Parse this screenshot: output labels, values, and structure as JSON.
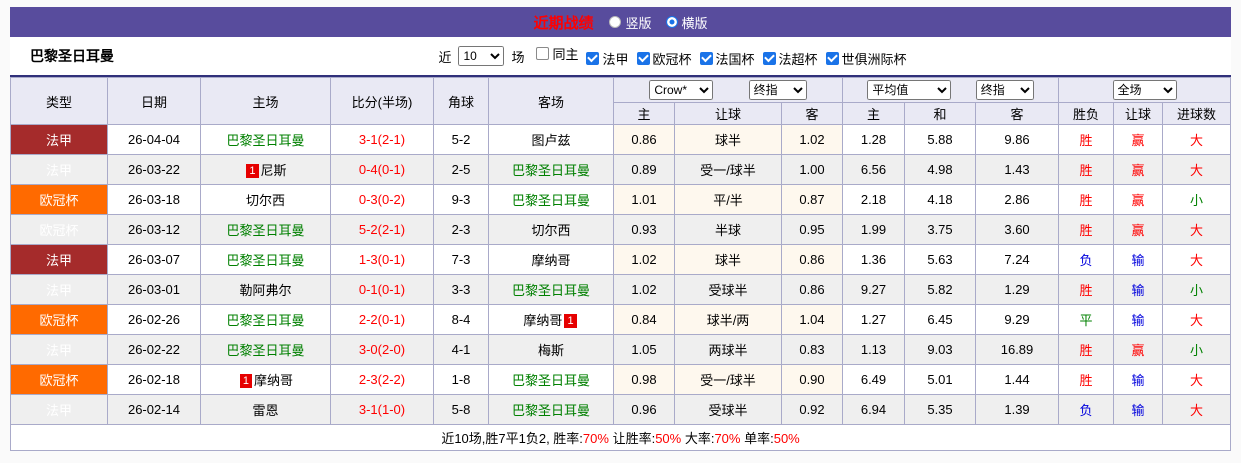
{
  "colors": {
    "topbar-bg": "#584c9d",
    "title-red": "#ff0000",
    "league-red": "#a52b2b",
    "league-orange": "#ff6a00",
    "text-red": "#ff0000",
    "text-blue": "#0000dd",
    "text-green": "#008000",
    "border": "#a9aac9",
    "header-bg": "#e9e9f4",
    "alt-row": "#efefef",
    "divider": "#30307a",
    "check-blue": "#1a73e8",
    "card-red": "#e60000"
  },
  "topbar": {
    "title": "近期战绩",
    "radios": [
      {
        "key": "vertical",
        "label": "竖版",
        "selected": false
      },
      {
        "key": "horizontal",
        "label": "横版",
        "selected": true
      }
    ]
  },
  "filterbar": {
    "team": "巴黎圣日耳曼",
    "near_label": "近",
    "match_count": "10",
    "matches_label": "场",
    "checkboxes": [
      {
        "key": "same-home",
        "label": "同主",
        "checked": false
      },
      {
        "key": "ligue1",
        "label": "法甲",
        "checked": true
      },
      {
        "key": "ucl",
        "label": "欧冠杯",
        "checked": true
      },
      {
        "key": "coupe-de-france",
        "label": "法国杯",
        "checked": true
      },
      {
        "key": "trophee-des-champions",
        "label": "法超杯",
        "checked": true
      },
      {
        "key": "club-world-cup",
        "label": "世俱洲际杯",
        "checked": true
      }
    ]
  },
  "table": {
    "selects": [
      {
        "name": "odds-company",
        "value": "Crow*"
      },
      {
        "name": "asian-final",
        "value": "终指"
      },
      {
        "name": "euro-company",
        "value": "平均值"
      },
      {
        "name": "euro-final",
        "value": "终指"
      },
      {
        "name": "scope",
        "value": "全场"
      }
    ],
    "headers": {
      "type": "类型",
      "date": "日期",
      "home": "主场",
      "score": "比分(半场)",
      "corner": "角球",
      "away": "客场",
      "sub": [
        "主",
        "让球",
        "客",
        "主",
        "和",
        "客",
        "胜负",
        "让球",
        "进球数"
      ]
    },
    "rows": [
      {
        "league": {
          "text": "法甲",
          "color": "red"
        },
        "date": "26-04-04",
        "home": {
          "name": "巴黎圣日耳曼",
          "green": true,
          "card": "",
          "card_pos": ""
        },
        "score": "3-1(2-1)",
        "corner": "5-2",
        "away": {
          "name": "图卢兹",
          "green": false,
          "card": "",
          "card_pos": ""
        },
        "asian": [
          "0.86",
          "球半",
          "1.02"
        ],
        "euro": [
          "1.28",
          "5.88",
          "9.86"
        ],
        "result": {
          "text": "胜",
          "color": "red"
        },
        "handicap": {
          "text": "赢",
          "color": "red"
        },
        "goals": {
          "text": "大",
          "color": "red"
        }
      },
      {
        "league": {
          "text": "法甲",
          "color": "red"
        },
        "date": "26-03-22",
        "home": {
          "name": "尼斯",
          "green": false,
          "card": "1",
          "card_pos": "before"
        },
        "score": "0-4(0-1)",
        "corner": "2-5",
        "away": {
          "name": "巴黎圣日耳曼",
          "green": true,
          "card": "",
          "card_pos": ""
        },
        "asian": [
          "0.89",
          "受一/球半",
          "1.00"
        ],
        "euro": [
          "6.56",
          "4.98",
          "1.43"
        ],
        "result": {
          "text": "胜",
          "color": "red"
        },
        "handicap": {
          "text": "赢",
          "color": "red"
        },
        "goals": {
          "text": "大",
          "color": "red"
        }
      },
      {
        "league": {
          "text": "欧冠杯",
          "color": "orange"
        },
        "date": "26-03-18",
        "home": {
          "name": "切尔西",
          "green": false,
          "card": "",
          "card_pos": ""
        },
        "score": "0-3(0-2)",
        "corner": "9-3",
        "away": {
          "name": "巴黎圣日耳曼",
          "green": true,
          "card": "",
          "card_pos": ""
        },
        "asian": [
          "1.01",
          "平/半",
          "0.87"
        ],
        "euro": [
          "2.18",
          "4.18",
          "2.86"
        ],
        "result": {
          "text": "胜",
          "color": "red"
        },
        "handicap": {
          "text": "赢",
          "color": "red"
        },
        "goals": {
          "text": "小",
          "color": "green"
        }
      },
      {
        "league": {
          "text": "欧冠杯",
          "color": "orange"
        },
        "date": "26-03-12",
        "home": {
          "name": "巴黎圣日耳曼",
          "green": true,
          "card": "",
          "card_pos": ""
        },
        "score": "5-2(2-1)",
        "corner": "2-3",
        "away": {
          "name": "切尔西",
          "green": false,
          "card": "",
          "card_pos": ""
        },
        "asian": [
          "0.93",
          "半球",
          "0.95"
        ],
        "euro": [
          "1.99",
          "3.75",
          "3.60"
        ],
        "result": {
          "text": "胜",
          "color": "red"
        },
        "handicap": {
          "text": "赢",
          "color": "red"
        },
        "goals": {
          "text": "大",
          "color": "red"
        }
      },
      {
        "league": {
          "text": "法甲",
          "color": "red"
        },
        "date": "26-03-07",
        "home": {
          "name": "巴黎圣日耳曼",
          "green": true,
          "card": "",
          "card_pos": ""
        },
        "score": "1-3(0-1)",
        "corner": "7-3",
        "away": {
          "name": "摩纳哥",
          "green": false,
          "card": "",
          "card_pos": ""
        },
        "asian": [
          "1.02",
          "球半",
          "0.86"
        ],
        "euro": [
          "1.36",
          "5.63",
          "7.24"
        ],
        "result": {
          "text": "负",
          "color": "blue"
        },
        "handicap": {
          "text": "输",
          "color": "blue"
        },
        "goals": {
          "text": "大",
          "color": "red"
        }
      },
      {
        "league": {
          "text": "法甲",
          "color": "red"
        },
        "date": "26-03-01",
        "home": {
          "name": "勒阿弗尔",
          "green": false,
          "card": "",
          "card_pos": ""
        },
        "score": "0-1(0-1)",
        "corner": "3-3",
        "away": {
          "name": "巴黎圣日耳曼",
          "green": true,
          "card": "",
          "card_pos": ""
        },
        "asian": [
          "1.02",
          "受球半",
          "0.86"
        ],
        "euro": [
          "9.27",
          "5.82",
          "1.29"
        ],
        "result": {
          "text": "胜",
          "color": "red"
        },
        "handicap": {
          "text": "输",
          "color": "blue"
        },
        "goals": {
          "text": "小",
          "color": "green"
        }
      },
      {
        "league": {
          "text": "欧冠杯",
          "color": "orange"
        },
        "date": "26-02-26",
        "home": {
          "name": "巴黎圣日耳曼",
          "green": true,
          "card": "",
          "card_pos": ""
        },
        "score": "2-2(0-1)",
        "corner": "8-4",
        "away": {
          "name": "摩纳哥",
          "green": false,
          "card": "1",
          "card_pos": "after"
        },
        "asian": [
          "0.84",
          "球半/两",
          "1.04"
        ],
        "euro": [
          "1.27",
          "6.45",
          "9.29"
        ],
        "result": {
          "text": "平",
          "color": "green"
        },
        "handicap": {
          "text": "输",
          "color": "blue"
        },
        "goals": {
          "text": "大",
          "color": "red"
        }
      },
      {
        "league": {
          "text": "法甲",
          "color": "red"
        },
        "date": "26-02-22",
        "home": {
          "name": "巴黎圣日耳曼",
          "green": true,
          "card": "",
          "card_pos": ""
        },
        "score": "3-0(2-0)",
        "corner": "4-1",
        "away": {
          "name": "梅斯",
          "green": false,
          "card": "",
          "card_pos": ""
        },
        "asian": [
          "1.05",
          "两球半",
          "0.83"
        ],
        "euro": [
          "1.13",
          "9.03",
          "16.89"
        ],
        "result": {
          "text": "胜",
          "color": "red"
        },
        "handicap": {
          "text": "赢",
          "color": "red"
        },
        "goals": {
          "text": "小",
          "color": "green"
        }
      },
      {
        "league": {
          "text": "欧冠杯",
          "color": "orange"
        },
        "date": "26-02-18",
        "home": {
          "name": "摩纳哥",
          "green": false,
          "card": "1",
          "card_pos": "before"
        },
        "score": "2-3(2-2)",
        "corner": "1-8",
        "away": {
          "name": "巴黎圣日耳曼",
          "green": true,
          "card": "",
          "card_pos": ""
        },
        "asian": [
          "0.98",
          "受一/球半",
          "0.90"
        ],
        "euro": [
          "6.49",
          "5.01",
          "1.44"
        ],
        "result": {
          "text": "胜",
          "color": "red"
        },
        "handicap": {
          "text": "输",
          "color": "blue"
        },
        "goals": {
          "text": "大",
          "color": "red"
        }
      },
      {
        "league": {
          "text": "法甲",
          "color": "red"
        },
        "date": "26-02-14",
        "home": {
          "name": "雷恩",
          "green": false,
          "card": "",
          "card_pos": ""
        },
        "score": "3-1(1-0)",
        "corner": "5-8",
        "away": {
          "name": "巴黎圣日耳曼",
          "green": true,
          "card": "",
          "card_pos": ""
        },
        "asian": [
          "0.96",
          "受球半",
          "0.92"
        ],
        "euro": [
          "6.94",
          "5.35",
          "1.39"
        ],
        "result": {
          "text": "负",
          "color": "blue"
        },
        "handicap": {
          "text": "输",
          "color": "blue"
        },
        "goals": {
          "text": "大",
          "color": "red"
        }
      }
    ]
  },
  "footer": {
    "segments": [
      {
        "text": "近10场,胜7平1负2, 胜率:",
        "color": "black"
      },
      {
        "text": "70%",
        "color": "red"
      },
      {
        "text": " 让胜率:",
        "color": "black"
      },
      {
        "text": "50%",
        "color": "red"
      },
      {
        "text": " 大率:",
        "color": "black"
      },
      {
        "text": "70%",
        "color": "red"
      },
      {
        "text": " 单率:",
        "color": "black"
      },
      {
        "text": "50%",
        "color": "red"
      }
    ]
  }
}
